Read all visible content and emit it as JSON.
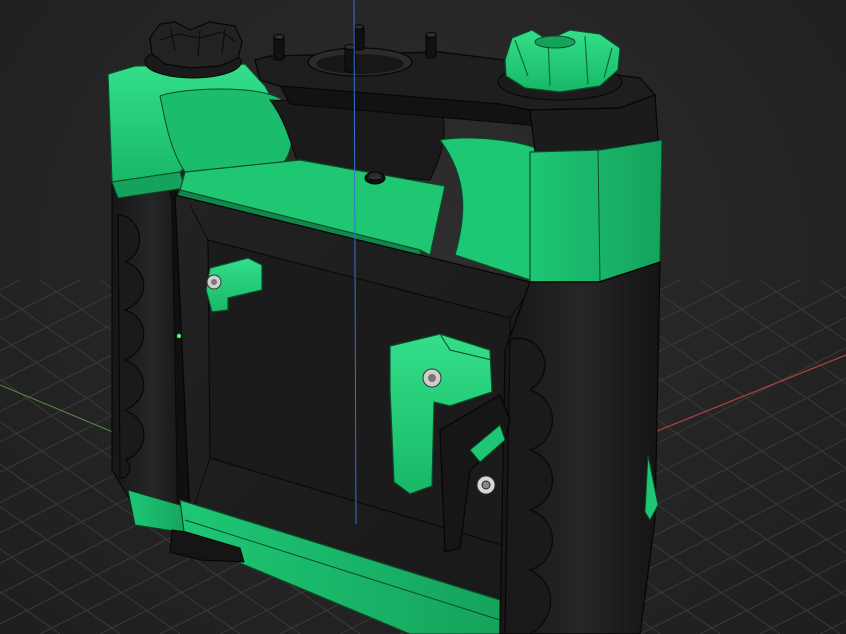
{
  "viewport": {
    "label": "",
    "background": "#262626"
  },
  "colors": {
    "body_green": "#1ec774",
    "body_green_dark": "#129a55",
    "body_green_light": "#35e08c",
    "body_black": "#1b1b1b",
    "body_black_mid": "#2a2a2a",
    "edge": "#0a0a0a",
    "grid": "#3a3a3a",
    "axis_x": "#b0463f",
    "axis_y": "#5a8a4a",
    "axis_z": "#3a6fd6"
  },
  "scene": {
    "model": "camera-cage-handle-assembly",
    "view_mode": "shaded-with-edges"
  }
}
